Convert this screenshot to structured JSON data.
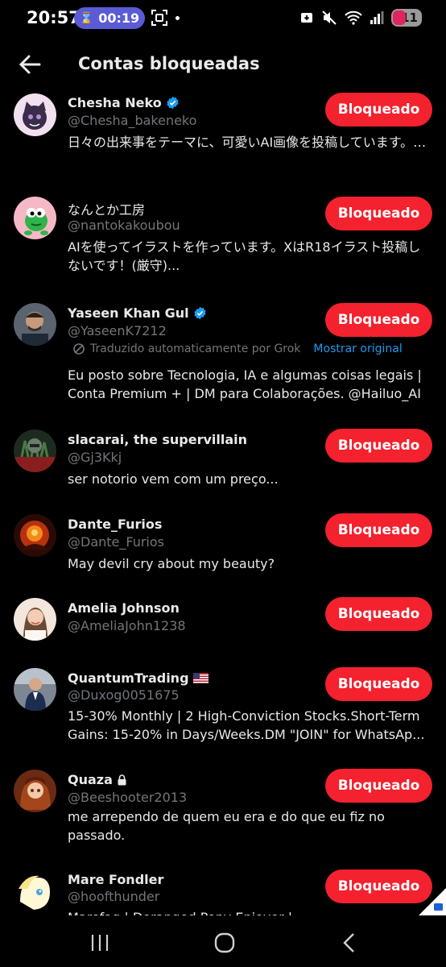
{
  "status_bar": {
    "time": "20:57",
    "timer": "00:19",
    "battery": "11"
  },
  "header": {
    "title": "Contas bloqueadas"
  },
  "accounts": [
    {
      "name": "Chesha Neko",
      "handle": "@Chesha_bakeneko",
      "verified": true,
      "bio": "日々の出来事をテーマに、可愛いAI画像を投稿しています。…",
      "button": "Bloqueado"
    },
    {
      "name": "なんとか工房",
      "handle": "@nantokakoubou",
      "verified": false,
      "bio": "AIを使ってイラストを作っています。XはR18イラスト投稿しないです！(厳守)...",
      "button": "Bloqueado"
    },
    {
      "name": "Yaseen Khan Gul",
      "handle": "@YaseenK7212",
      "verified": true,
      "translation": "Traduzido automaticamente por Grok",
      "show_original": "Mostrar original",
      "bio": "Eu posto sobre Tecnologia, IA e algumas coisas legais | Conta Premium + | DM para Colaborações. @Hailuo_AI",
      "button": "Bloqueado"
    },
    {
      "name": "slacarai, the supervillain",
      "handle": "@Gj3Kkj",
      "verified": false,
      "bio": "ser notorio vem com um preço...",
      "button": "Bloqueado"
    },
    {
      "name": "Dante_Furios",
      "handle": "@Dante_Furios",
      "verified": false,
      "bio": "May devil cry about my beauty?",
      "button": "Bloqueado"
    },
    {
      "name": "Amelia Johnson",
      "handle": "@AmeliaJohn1238",
      "verified": false,
      "bio": "",
      "button": "Bloqueado"
    },
    {
      "name": "QuantumTrading",
      "handle": "@Duxog0051675",
      "verified": false,
      "flag": "us-flag",
      "bio": "15-30% Monthly | 2 High-Conviction Stocks.Short-Term Gains: 15-20% in Days/Weeks.DM \"JOIN\" for WhatsAp...",
      "button": "Bloqueado"
    },
    {
      "name": "Quaza",
      "handle": "@Beeshooter2013",
      "verified": false,
      "locked": true,
      "bio": "me arrependo de quem eu era e do que eu fiz no passado.",
      "button": "Bloqueado"
    },
    {
      "name": "Mare Fondler",
      "handle": "@hoofthunder",
      "verified": false,
      "bio": "Marefag | Deranged Pony Enjoyer |",
      "button": "Bloqueado"
    }
  ],
  "colors": {
    "background": "#000000",
    "button": "#f4212e",
    "verified": "#1d9bf0",
    "muted": "#71767b",
    "link": "#1d9bf0"
  },
  "icons": {
    "back": "back-arrow-icon",
    "verified": "verified-badge-icon",
    "lock": "lock-icon",
    "translate": "grok-translate-icon",
    "nav": [
      "recent-apps-icon",
      "home-icon",
      "back-icon"
    ]
  }
}
